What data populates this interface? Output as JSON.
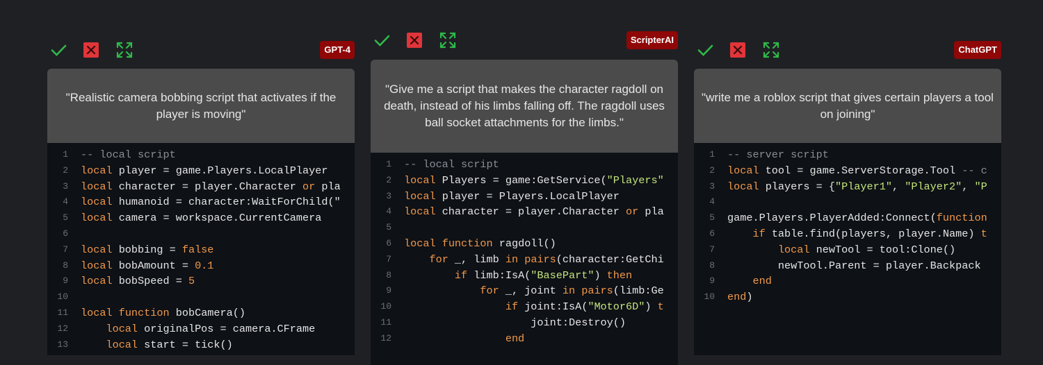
{
  "colors": {
    "background": "#1f2024",
    "badge": "#8f0707",
    "check": "#2fb94a",
    "close_bg": "#e0353a",
    "expand": "#2fb94a",
    "prompt_bg": "#4b4b4b",
    "code_bg": "#0e1116",
    "keyword": "#f2994a",
    "string": "#c4e57a",
    "comment": "#8a8f96"
  },
  "panels": [
    {
      "badge": "GPT-4",
      "icons": [
        "check-icon",
        "close-icon",
        "expand-icon"
      ],
      "prompt": "\"Realistic camera bobbing script that activates if the player is moving\"",
      "code_lines": [
        {
          "n": "1",
          "tokens": [
            {
              "t": "-- local script",
              "c": "com"
            }
          ]
        },
        {
          "n": "2",
          "tokens": [
            {
              "t": "local",
              "c": "kw"
            },
            {
              "t": " player = game.Players.LocalPlayer",
              "c": "pl"
            }
          ]
        },
        {
          "n": "3",
          "tokens": [
            {
              "t": "local",
              "c": "kw"
            },
            {
              "t": " character = player.Character ",
              "c": "pl"
            },
            {
              "t": "or",
              "c": "kw"
            },
            {
              "t": " pla",
              "c": "pl"
            }
          ]
        },
        {
          "n": "4",
          "tokens": [
            {
              "t": "local",
              "c": "kw"
            },
            {
              "t": " humanoid = character:WaitForChild(\"",
              "c": "pl"
            }
          ]
        },
        {
          "n": "5",
          "tokens": [
            {
              "t": "local",
              "c": "kw"
            },
            {
              "t": " camera = workspace.CurrentCamera",
              "c": "pl"
            }
          ]
        },
        {
          "n": "6",
          "tokens": []
        },
        {
          "n": "7",
          "tokens": [
            {
              "t": "local",
              "c": "kw"
            },
            {
              "t": " bobbing = ",
              "c": "pl"
            },
            {
              "t": "false",
              "c": "kw"
            }
          ]
        },
        {
          "n": "8",
          "tokens": [
            {
              "t": "local",
              "c": "kw"
            },
            {
              "t": " bobAmount = ",
              "c": "pl"
            },
            {
              "t": "0.1",
              "c": "num"
            }
          ]
        },
        {
          "n": "9",
          "tokens": [
            {
              "t": "local",
              "c": "kw"
            },
            {
              "t": " bobSpeed = ",
              "c": "pl"
            },
            {
              "t": "5",
              "c": "num"
            }
          ]
        },
        {
          "n": "10",
          "tokens": []
        },
        {
          "n": "11",
          "tokens": [
            {
              "t": "local",
              "c": "kw"
            },
            {
              "t": " ",
              "c": "pl"
            },
            {
              "t": "function",
              "c": "kw"
            },
            {
              "t": " bobCamera()",
              "c": "pl"
            }
          ]
        },
        {
          "n": "12",
          "tokens": [
            {
              "t": "    ",
              "c": "pl"
            },
            {
              "t": "local",
              "c": "kw"
            },
            {
              "t": " originalPos = camera.CFrame",
              "c": "pl"
            }
          ]
        },
        {
          "n": "13",
          "tokens": [
            {
              "t": "    ",
              "c": "pl"
            },
            {
              "t": "local",
              "c": "kw"
            },
            {
              "t": " start = tick()",
              "c": "pl"
            }
          ]
        }
      ]
    },
    {
      "badge": "ScripterAI",
      "icons": [
        "check-icon",
        "close-icon",
        "expand-icon"
      ],
      "prompt": "\"Give me a script that makes the character ragdoll on death, instead of his limbs falling off. The ragdoll uses ball socket attachments for the limbs.\"",
      "code_lines": [
        {
          "n": "1",
          "tokens": [
            {
              "t": "-- local script",
              "c": "com"
            }
          ]
        },
        {
          "n": "2",
          "tokens": [
            {
              "t": "local",
              "c": "kw"
            },
            {
              "t": " Players = game:GetService(",
              "c": "pl"
            },
            {
              "t": "\"Players\"",
              "c": "str"
            }
          ]
        },
        {
          "n": "3",
          "tokens": [
            {
              "t": "local",
              "c": "kw"
            },
            {
              "t": " player = Players.LocalPlayer",
              "c": "pl"
            }
          ]
        },
        {
          "n": "4",
          "tokens": [
            {
              "t": "local",
              "c": "kw"
            },
            {
              "t": " character = player.Character ",
              "c": "pl"
            },
            {
              "t": "or",
              "c": "kw"
            },
            {
              "t": " pla",
              "c": "pl"
            }
          ]
        },
        {
          "n": "5",
          "tokens": []
        },
        {
          "n": "6",
          "tokens": [
            {
              "t": "local",
              "c": "kw"
            },
            {
              "t": " ",
              "c": "pl"
            },
            {
              "t": "function",
              "c": "kw"
            },
            {
              "t": " ragdoll()",
              "c": "pl"
            }
          ]
        },
        {
          "n": "7",
          "tokens": [
            {
              "t": "    ",
              "c": "pl"
            },
            {
              "t": "for",
              "c": "kw"
            },
            {
              "t": " _, limb ",
              "c": "pl"
            },
            {
              "t": "in",
              "c": "kw"
            },
            {
              "t": " ",
              "c": "pl"
            },
            {
              "t": "pairs",
              "c": "kw"
            },
            {
              "t": "(character:GetChi",
              "c": "pl"
            }
          ]
        },
        {
          "n": "8",
          "tokens": [
            {
              "t": "        ",
              "c": "pl"
            },
            {
              "t": "if",
              "c": "kw"
            },
            {
              "t": " limb:IsA(",
              "c": "pl"
            },
            {
              "t": "\"BasePart\"",
              "c": "str"
            },
            {
              "t": ") ",
              "c": "pl"
            },
            {
              "t": "then",
              "c": "kw"
            }
          ]
        },
        {
          "n": "9",
          "tokens": [
            {
              "t": "            ",
              "c": "pl"
            },
            {
              "t": "for",
              "c": "kw"
            },
            {
              "t": " _, joint ",
              "c": "pl"
            },
            {
              "t": "in",
              "c": "kw"
            },
            {
              "t": " ",
              "c": "pl"
            },
            {
              "t": "pairs",
              "c": "kw"
            },
            {
              "t": "(limb:Ge",
              "c": "pl"
            }
          ]
        },
        {
          "n": "10",
          "tokens": [
            {
              "t": "                ",
              "c": "pl"
            },
            {
              "t": "if",
              "c": "kw"
            },
            {
              "t": " joint:IsA(",
              "c": "pl"
            },
            {
              "t": "\"Motor6D\"",
              "c": "str"
            },
            {
              "t": ") ",
              "c": "pl"
            },
            {
              "t": "t",
              "c": "kw"
            }
          ]
        },
        {
          "n": "11",
          "tokens": [
            {
              "t": "                    joint:Destroy()",
              "c": "pl"
            }
          ]
        },
        {
          "n": "12",
          "tokens": [
            {
              "t": "                ",
              "c": "pl"
            },
            {
              "t": "end",
              "c": "kw"
            }
          ]
        }
      ]
    },
    {
      "badge": "ChatGPT",
      "icons": [
        "check-icon",
        "close-icon",
        "expand-icon"
      ],
      "prompt": "\"write me a roblox script that gives certain players a tool on joining\"",
      "code_lines": [
        {
          "n": "1",
          "tokens": [
            {
              "t": "-- server script",
              "c": "com"
            }
          ]
        },
        {
          "n": "2",
          "tokens": [
            {
              "t": "local",
              "c": "kw"
            },
            {
              "t": " tool = game.ServerStorage.Tool ",
              "c": "pl"
            },
            {
              "t": "-- c",
              "c": "com"
            }
          ]
        },
        {
          "n": "3",
          "tokens": [
            {
              "t": "local",
              "c": "kw"
            },
            {
              "t": " players = {",
              "c": "pl"
            },
            {
              "t": "\"Player1\"",
              "c": "str"
            },
            {
              "t": ", ",
              "c": "pl"
            },
            {
              "t": "\"Player2\"",
              "c": "str"
            },
            {
              "t": ", ",
              "c": "pl"
            },
            {
              "t": "\"P",
              "c": "str"
            }
          ]
        },
        {
          "n": "4",
          "tokens": []
        },
        {
          "n": "5",
          "tokens": [
            {
              "t": "game.Players.PlayerAdded:Connect(",
              "c": "pl"
            },
            {
              "t": "function",
              "c": "kw"
            }
          ]
        },
        {
          "n": "6",
          "tokens": [
            {
              "t": "    ",
              "c": "pl"
            },
            {
              "t": "if",
              "c": "kw"
            },
            {
              "t": " table.find(players, player.Name) ",
              "c": "pl"
            },
            {
              "t": "t",
              "c": "kw"
            }
          ]
        },
        {
          "n": "7",
          "tokens": [
            {
              "t": "        ",
              "c": "pl"
            },
            {
              "t": "local",
              "c": "kw"
            },
            {
              "t": " newTool = tool:Clone()",
              "c": "pl"
            }
          ]
        },
        {
          "n": "8",
          "tokens": [
            {
              "t": "        newTool.Parent = player.Backpack",
              "c": "pl"
            }
          ]
        },
        {
          "n": "9",
          "tokens": [
            {
              "t": "    ",
              "c": "pl"
            },
            {
              "t": "end",
              "c": "kw"
            }
          ]
        },
        {
          "n": "10",
          "tokens": [
            {
              "t": "end",
              "c": "kw"
            },
            {
              "t": ")",
              "c": "pl"
            }
          ]
        }
      ]
    }
  ]
}
